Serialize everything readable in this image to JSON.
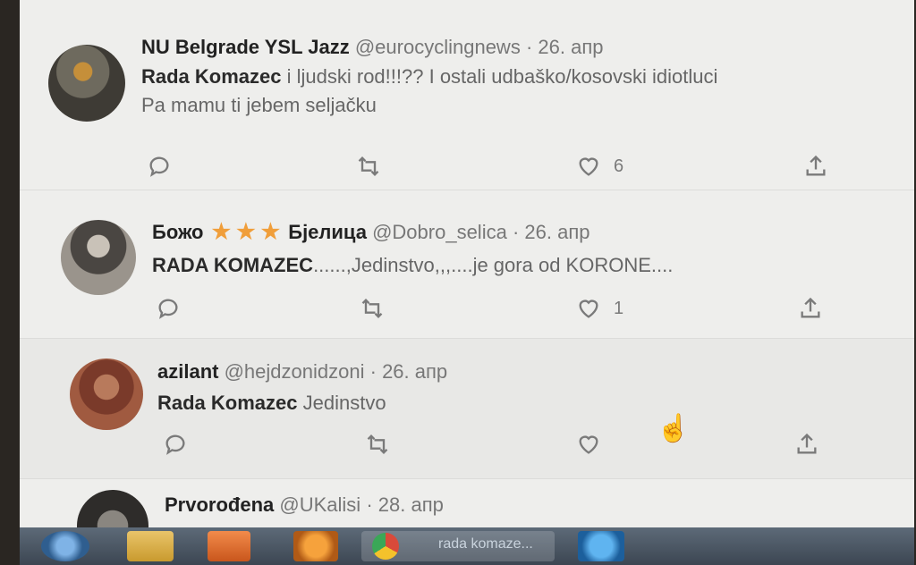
{
  "tweets": [
    {
      "display_name": "NU Belgrade YSL Jazz",
      "handle": "@eurocyclingnews",
      "separator": "·",
      "date": "26. апр",
      "mention": "Rada Komazec",
      "text_line1": " i ljudski rod!!!?? I ostali udbaško/kosovski idiotluci",
      "text_line2": "Pa mamu ti jebem seljačku",
      "like_count": "6"
    },
    {
      "display_name_first": "Божо",
      "stars": [
        "★",
        "★",
        "★"
      ],
      "display_name_last": "Бјелица",
      "handle": "@Dobro_selica",
      "separator": "·",
      "date": "26. апр",
      "mention": "RADA KOMAZEC",
      "text_line1": "......,Jedinstvo,,,....je gora od KORONE....",
      "like_count": "1"
    },
    {
      "display_name": "azilant",
      "handle": "@hejdzonidzoni",
      "separator": "·",
      "date": "26. апр",
      "mention": "Rada Komazec",
      "text_line1": " Jedinstvo",
      "like_count": ""
    },
    {
      "display_name": "Prvorođena",
      "handle": "@UKalisi",
      "separator": "·",
      "date": "28. апр"
    }
  ],
  "taskbar": {
    "active_window_label": "rada komaze..."
  },
  "icons": {
    "reply": "reply-icon",
    "retweet": "retweet-icon",
    "like": "heart-icon",
    "share": "share-icon"
  },
  "colors": {
    "star": "#f09e3a",
    "screen_bg": "#eeeeec"
  }
}
